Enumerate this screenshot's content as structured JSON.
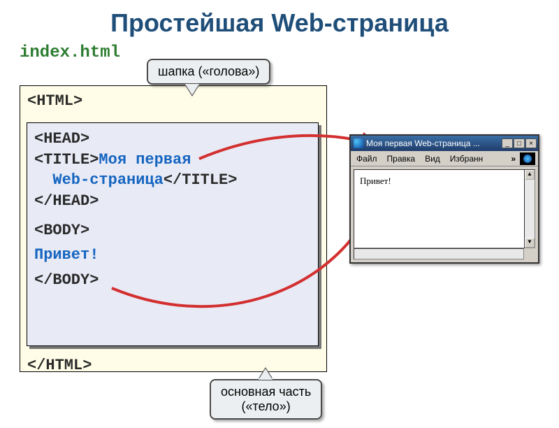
{
  "title": "Простейшая Web-страница",
  "filename": "index.html",
  "code": {
    "html_open": "<HTML>",
    "head_open": "<HEAD>",
    "title_open": "<TITLE>",
    "title_text_line1": "Моя первая",
    "title_text_line2": "Web-страница",
    "title_close": "</TITLE>",
    "head_close": "</HEAD>",
    "body_open": "<BODY>",
    "body_text": "Привет!",
    "body_close": "</BODY>",
    "html_close": "</HTML>"
  },
  "callouts": {
    "head": "шапка («голова»)",
    "body_line1": "основная часть",
    "body_line2": "(«тело»)"
  },
  "browser": {
    "title": "Моя первая Web-страница ...",
    "menu": {
      "file": "Файл",
      "edit": "Правка",
      "view": "Вид",
      "fav": "Избранн",
      "chev": "»"
    },
    "content": "Привет!"
  }
}
